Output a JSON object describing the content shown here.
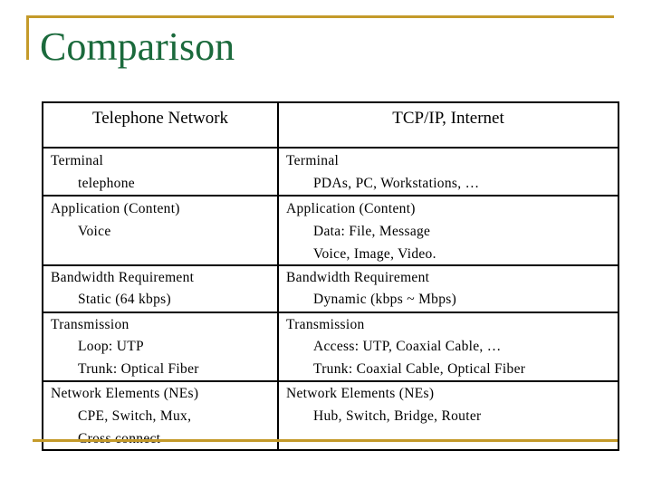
{
  "slide": {
    "title": "Comparison",
    "accent_color": "#c49a2a",
    "title_color": "#1b6a3c"
  },
  "table": {
    "headers": [
      "Telephone Network",
      "TCP/IP, Internet"
    ],
    "rows": [
      {
        "left": {
          "heading": "Terminal",
          "items": [
            "telephone"
          ]
        },
        "right": {
          "heading": "Terminal",
          "items": [
            "PDAs, PC, Workstations, …"
          ]
        }
      },
      {
        "left": {
          "heading": "Application (Content)",
          "items": [
            "Voice"
          ]
        },
        "right": {
          "heading": "Application (Content)",
          "items": [
            "Data: File, Message",
            "Voice, Image, Video."
          ]
        }
      },
      {
        "left": {
          "heading": "Bandwidth Requirement",
          "items": [
            "Static (64 kbps)"
          ]
        },
        "right": {
          "heading": "Bandwidth Requirement",
          "items": [
            "Dynamic (kbps ~ Mbps)"
          ]
        }
      },
      {
        "left": {
          "heading": "Transmission",
          "items": [
            "Loop: UTP",
            "Trunk: Optical Fiber"
          ]
        },
        "right": {
          "heading": "Transmission",
          "items": [
            "Access: UTP, Coaxial Cable, …",
            "Trunk: Coaxial Cable, Optical Fiber"
          ]
        }
      },
      {
        "left": {
          "heading": "Network Elements (NEs)",
          "items": [
            "CPE, Switch, Mux,",
            "Cross connect"
          ]
        },
        "right": {
          "heading": "Network Elements (NEs)",
          "items": [
            "Hub, Switch, Bridge, Router"
          ]
        }
      }
    ]
  }
}
